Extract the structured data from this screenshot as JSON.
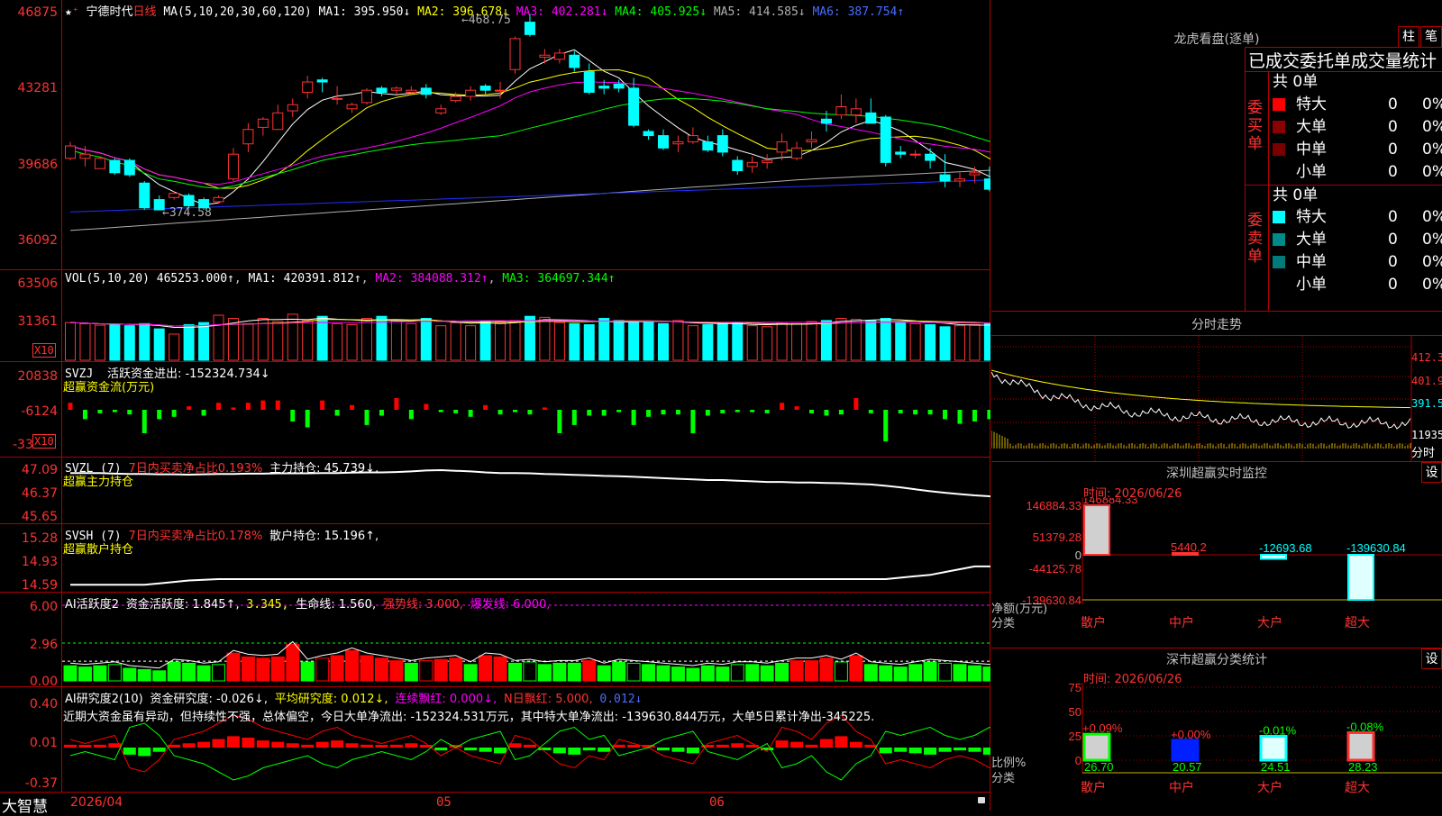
{
  "header": {
    "stock_name": "宁德时代",
    "period": "日线",
    "ma_label": "MA(5,10,20,30,60,120)",
    "ma1": "MA1: 395.950↓",
    "ma2": "MA2: 396.678↓",
    "ma3": "MA3: 402.281↓",
    "ma4": "MA4: 405.925↓",
    "ma5": "MA5: 414.585↓",
    "ma6": "MA6: 387.754↑",
    "max_label": "468.75",
    "min_label": "374.58"
  },
  "axes": {
    "price": [
      "46875",
      "43281",
      "39686",
      "36092"
    ],
    "vol": [
      "63506",
      "31361",
      "X10"
    ],
    "svzj": [
      "20838",
      "-6124",
      "-33",
      "X10"
    ],
    "svzl": [
      "47.09",
      "46.37",
      "45.65"
    ],
    "svsh": [
      "15.28",
      "14.93",
      "14.59"
    ],
    "ai1": [
      "6.00",
      "2.96",
      "0.00"
    ],
    "ai2": [
      "0.40",
      "0.01",
      "-0.37"
    ]
  },
  "vol_header": {
    "label": "VOL(5,10,20)",
    "v": "465253.000↑",
    "ma1": "MA1: 420391.812↑",
    "ma2": "MA2: 384088.312↑",
    "ma3": "MA3: 364697.344↑"
  },
  "svzj_header": {
    "label": "SVZJ",
    "text": "活跃资金进出: -152324.734↓",
    "sub": "超赢资金流(万元)"
  },
  "svzl_header": {
    "label": "SVZL (7)",
    "text1": "7日内买卖净占比0.193%",
    "text2": "主力持仓: 45.739↓,",
    "sub": "超赢主力持仓"
  },
  "svsh_header": {
    "label": "SVSH (7)",
    "text1": "7日内买卖净占比0.178%",
    "text2": "散户持仓: 15.196↑,",
    "sub": "超赢散户持仓"
  },
  "ai1_header": {
    "label": "AI活跃度2",
    "t1": "资金活跃度: 1.845↑,",
    "t2": "3.345,",
    "t3": "生命线: 1.560,",
    "t4": "强势线: 3.000,",
    "t5": "爆发线: 6.000,"
  },
  "ai2_header": {
    "label": "AI研究度2(10)",
    "t1": "资金研究度: -0.026↓,",
    "t2": "平均研究度: 0.012↓,",
    "t3": "连续飘红: 0.000↓,",
    "t4": "N日飘红: 5.000,",
    "t5": "0.012↓",
    "note": "近期大资金虽有异动，但持续性不强，总体偏空，今日大单净流出: -152324.531万元，其中特大单净流出: -139630.844万元，大单5日累计净出-345225."
  },
  "bottom": {
    "app": "大智慧",
    "date": "2026/04",
    "m5": "05",
    "m6": "06"
  },
  "lhb": {
    "title": "龙虎看盘(逐单)",
    "btn1": "柱",
    "btn2": "笔",
    "subtitle": "已成交委托单成交量统计",
    "buy_label": "委买单",
    "sell_label": "委卖单",
    "buy_total": "共 0单",
    "sell_total": "共 0单",
    "rows": [
      {
        "name": "特大",
        "qty": "0",
        "pct": "0%"
      },
      {
        "name": "大单",
        "qty": "0",
        "pct": "0%"
      },
      {
        "name": "中单",
        "qty": "0",
        "pct": "0%"
      },
      {
        "name": "小单",
        "qty": "0",
        "pct": "0%"
      }
    ],
    "buy_colors": [
      "#ff0000",
      "#8b0000",
      "#7a0000",
      ""
    ],
    "sell_colors": [
      "#00ffff",
      "#008b8b",
      "#007a7a",
      ""
    ]
  },
  "intraday": {
    "title": "分时走势",
    "p1": "412.3",
    "p2": "401.9",
    "p3": "391.5",
    "vol": "11935",
    "foot": "分时"
  },
  "sz_monitor": {
    "title": "深圳超赢实时监控",
    "btn": "设",
    "time": "时间: 2026/06/26",
    "yaxis": [
      "146884.33",
      "51379.28",
      "0",
      "-44125.78",
      "-139630.84"
    ],
    "ylabel1": "净额(万元)",
    "ylabel2": "分类",
    "cats": [
      "散户",
      "中户",
      "大户",
      "超大"
    ],
    "vals": [
      "146884.33",
      "5440.2",
      "-12693.68",
      "-139630.84"
    ],
    "nums": [
      146884.33,
      5440.2,
      -12693.68,
      -139630.84
    ]
  },
  "class_stats": {
    "title": "深市超赢分类统计",
    "btn": "设",
    "time": "时间: 2026/06/26",
    "yaxis": [
      "75",
      "50",
      "25",
      "0"
    ],
    "ylabel1": "比例%",
    "ylabel2": "分类",
    "cats": [
      "散户",
      "中户",
      "大户",
      "超大"
    ],
    "tops": [
      "+0.09%",
      "+0.00%",
      "-0.01%",
      "-0.08%"
    ],
    "bottoms": [
      "26.70",
      "20.57",
      "24.51",
      "28.23"
    ],
    "nums": [
      26.7,
      20.57,
      24.51,
      28.23
    ]
  },
  "colors": {
    "up": "#ff3232",
    "down": "#00ffff",
    "frame": "#b00000"
  },
  "candles": [
    [
      399,
      405,
      398,
      407
    ],
    [
      399,
      401,
      395,
      405
    ],
    [
      394,
      399,
      394,
      400
    ],
    [
      398,
      392,
      391,
      399
    ],
    [
      398,
      391,
      390,
      399
    ],
    [
      387,
      375,
      374,
      388
    ],
    [
      379,
      374,
      374,
      381
    ],
    [
      380,
      382,
      379,
      383
    ],
    [
      381,
      376,
      375,
      382
    ],
    [
      379,
      375,
      374,
      380
    ],
    [
      378,
      380,
      377,
      381
    ],
    [
      389,
      401,
      388,
      404
    ],
    [
      406,
      413,
      402,
      416
    ],
    [
      414,
      418,
      410,
      419
    ],
    [
      413,
      421,
      413,
      425
    ],
    [
      422,
      425,
      419,
      428
    ],
    [
      431,
      436,
      428,
      439
    ],
    [
      437,
      436,
      431,
      438
    ],
    [
      428,
      428,
      425,
      434
    ],
    [
      423,
      425,
      421,
      426
    ],
    [
      426,
      432,
      425,
      433
    ],
    [
      433,
      431,
      429,
      434
    ],
    [
      432,
      433,
      430,
      434
    ],
    [
      431,
      432,
      430,
      434
    ],
    [
      433,
      430,
      428,
      435
    ],
    [
      421,
      423,
      420,
      425
    ],
    [
      427,
      429,
      426,
      431
    ],
    [
      429,
      432,
      427,
      434
    ],
    [
      434,
      432,
      430,
      435
    ],
    [
      432,
      432,
      428,
      436
    ],
    [
      442,
      457,
      440,
      458
    ],
    [
      465,
      459,
      458,
      469
    ],
    [
      448,
      449,
      445,
      452
    ],
    [
      447,
      450,
      445,
      452
    ],
    [
      449,
      443,
      441,
      451
    ],
    [
      441,
      431,
      430,
      445
    ],
    [
      434,
      433,
      430,
      437
    ],
    [
      435,
      433,
      431,
      437
    ],
    [
      433,
      415,
      414,
      438
    ],
    [
      412,
      410,
      408,
      413
    ],
    [
      410,
      404,
      403,
      413
    ],
    [
      406,
      407,
      402,
      410
    ],
    [
      407,
      410,
      406,
      414
    ],
    [
      407,
      403,
      402,
      410
    ],
    [
      410,
      402,
      400,
      413
    ],
    [
      398,
      393,
      391,
      400
    ],
    [
      395,
      397,
      392,
      400
    ],
    [
      397,
      398,
      394,
      401
    ],
    [
      402,
      407,
      398,
      411
    ],
    [
      399,
      404,
      398,
      407
    ],
    [
      407,
      408,
      404,
      412
    ],
    [
      418,
      416,
      412,
      422
    ],
    [
      420,
      424,
      418,
      430
    ],
    [
      420,
      423,
      416,
      428
    ],
    [
      421,
      416,
      416,
      428
    ],
    [
      419,
      397,
      395,
      420
    ],
    [
      402,
      401,
      399,
      405
    ],
    [
      401,
      401,
      399,
      403
    ],
    [
      401,
      398,
      394,
      404
    ],
    [
      391,
      388,
      385,
      401
    ],
    [
      388,
      389,
      385,
      392
    ],
    [
      391,
      392,
      387,
      395
    ],
    [
      389,
      384,
      383,
      395
    ],
    [
      386,
      387,
      384,
      390
    ],
    [
      391,
      392,
      388,
      394
    ],
    [
      400,
      392,
      389,
      402
    ],
    [
      401,
      398,
      395,
      405
    ],
    [
      399,
      397,
      394,
      401
    ],
    [
      392,
      390,
      385,
      395
    ],
    [
      398,
      405,
      393,
      407
    ],
    [
      401,
      392,
      387,
      404
    ],
    [
      394,
      394,
      391,
      397
    ],
    [
      398,
      399,
      397,
      402
    ],
    [
      397,
      386,
      385,
      398
    ]
  ],
  "volumes": [
    36000,
    35000,
    33500,
    34000,
    33000,
    35000,
    30000,
    25000,
    34000,
    36000,
    43000,
    40000,
    35000,
    40000,
    37000,
    44000,
    38000,
    42000,
    35000,
    34000,
    40000,
    42000,
    38000,
    35000,
    40000,
    33000,
    36000,
    33000,
    37000,
    36000,
    38000,
    42000,
    41000,
    36000,
    35000,
    34000,
    40000,
    38000,
    36000,
    37000,
    35000,
    38000,
    33000,
    34000,
    35000,
    36000,
    33000,
    32000,
    36000,
    35000,
    37000,
    38000,
    40000,
    39000,
    38000,
    40000,
    36000,
    35000,
    34000,
    32000,
    33000,
    34000,
    35000,
    34000,
    32000,
    33000,
    36000,
    35000,
    34000,
    48000,
    36000,
    35000,
    38000,
    42000
  ],
  "flows": [
    6,
    -8,
    -3,
    -2,
    -4,
    -20,
    -8,
    -6,
    3,
    -5,
    6,
    2,
    6,
    8,
    8,
    -10,
    -15,
    8,
    -5,
    4,
    -13,
    -5,
    10,
    -8,
    5,
    -2,
    -3,
    -6,
    4,
    -4,
    -2,
    -4,
    2,
    -20,
    -13,
    -5,
    -5,
    -2,
    -13,
    -6,
    -4,
    -4,
    -20,
    -5,
    -3,
    -2,
    -2,
    -3,
    6,
    3,
    -3,
    -5,
    -4,
    10,
    -3,
    -27,
    -3,
    -4,
    -4,
    -8,
    -12,
    -10,
    -8,
    -12,
    -11,
    20,
    4,
    4,
    -6,
    -11,
    -13,
    -7,
    -4,
    -13
  ],
  "svzl": [
    47.0,
    47.0,
    47.0,
    46.98,
    46.97,
    46.97,
    46.96,
    46.96,
    46.95,
    46.96,
    46.97,
    46.97,
    46.98,
    46.98,
    46.99,
    46.99,
    46.99,
    47.0,
    47.0,
    47.01,
    47.02,
    47.02,
    47.03,
    47.05,
    47.08,
    47.09,
    47.07,
    47.05,
    47.02,
    47.0,
    47.0,
    46.99,
    46.97,
    46.96,
    46.94,
    46.93,
    46.91,
    46.9,
    46.88,
    46.86,
    46.84,
    46.82,
    46.8,
    46.78,
    46.78,
    46.76,
    46.74,
    46.72,
    46.72,
    46.7,
    46.7,
    46.69,
    46.68,
    46.66,
    46.64,
    46.6,
    46.55,
    46.49,
    46.43,
    46.38,
    46.34,
    46.3,
    46.27,
    46.24,
    46.22,
    46.2,
    46.18,
    46.15,
    46.13,
    46.1,
    46.06,
    46.02,
    45.98,
    45.8
  ],
  "svsh": [
    14.6,
    14.6,
    14.6,
    14.6,
    14.6,
    14.6,
    14.62,
    14.64,
    14.66,
    14.67,
    14.68,
    14.68,
    14.68,
    14.68,
    14.68,
    14.68,
    14.68,
    14.68,
    14.68,
    14.68,
    14.68,
    14.68,
    14.68,
    14.68,
    14.68,
    14.68,
    14.68,
    14.68,
    14.68,
    14.68,
    14.68,
    14.68,
    14.68,
    14.68,
    14.68,
    14.68,
    14.68,
    14.68,
    14.68,
    14.68,
    14.68,
    14.68,
    14.68,
    14.68,
    14.68,
    14.68,
    14.68,
    14.68,
    14.68,
    14.68,
    14.68,
    14.68,
    14.68,
    14.68,
    14.68,
    14.68,
    14.7,
    14.72,
    14.74,
    14.78,
    14.82,
    14.86,
    14.86,
    14.87,
    14.88,
    14.9,
    14.93,
    14.95,
    14.96,
    14.98,
    15.0,
    15.02,
    15.08,
    15.2
  ],
  "ai_act": [
    1.2,
    1.1,
    1.2,
    1.3,
    1.0,
    0.9,
    0.8,
    1.5,
    1.4,
    1.2,
    1.3,
    2.2,
    1.9,
    1.8,
    1.9,
    2.9,
    1.5,
    1.8,
    2.0,
    2.4,
    2.0,
    1.8,
    1.6,
    1.4,
    1.6,
    1.7,
    1.8,
    1.3,
    2.0,
    1.9,
    1.4,
    1.5,
    1.3,
    1.4,
    1.4,
    1.6,
    1.2,
    1.5,
    1.4,
    1.3,
    1.2,
    1.1,
    1.0,
    1.2,
    1.1,
    1.3,
    1.3,
    1.2,
    1.4,
    1.6,
    1.6,
    1.8,
    1.5,
    2.0,
    1.3,
    1.2,
    1.1,
    1.3,
    1.5,
    1.4,
    1.3,
    1.2,
    1.1,
    1.2,
    1.3,
    1.4,
    1.2,
    1.3,
    1.4,
    2.5,
    1.4,
    1.3,
    1.4,
    1.7
  ],
  "ai_res": [
    0.02,
    0.01,
    0.02,
    0.03,
    -0.05,
    -0.06,
    -0.03,
    0.02,
    0.03,
    0.04,
    0.06,
    0.08,
    0.07,
    0.05,
    0.04,
    0.03,
    0.02,
    0.04,
    0.05,
    0.03,
    0.02,
    0.01,
    0.02,
    0.03,
    0.01,
    -0.02,
    0.0,
    -0.02,
    -0.03,
    -0.04,
    0.03,
    0.02,
    -0.01,
    -0.04,
    -0.05,
    -0.02,
    -0.03,
    0.02,
    0.01,
    0.0,
    -0.02,
    -0.03,
    -0.04,
    0.01,
    0.02,
    0.03,
    0.01,
    -0.01,
    0.05,
    0.04,
    0.02,
    0.06,
    0.08,
    0.04,
    0.02,
    -0.04,
    -0.03,
    -0.04,
    -0.05,
    -0.03,
    -0.02,
    -0.03,
    -0.05,
    -0.04,
    -0.03,
    0.05,
    0.03,
    0.02,
    -0.02,
    -0.04,
    -0.02,
    -0.03,
    -0.02,
    -0.026
  ]
}
